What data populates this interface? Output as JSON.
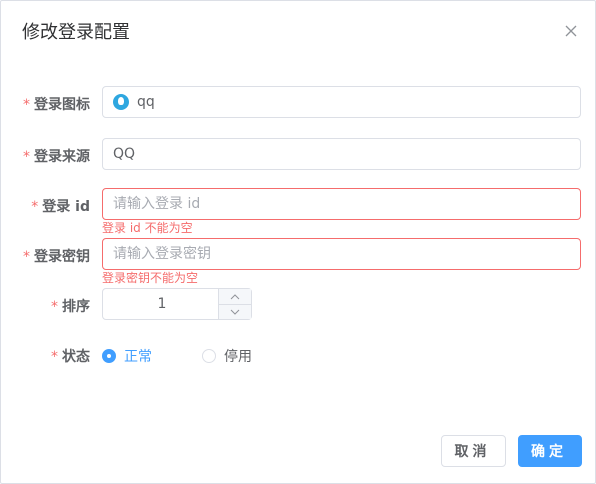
{
  "dialog": {
    "title": "修改登录配置"
  },
  "form": {
    "required_mark": "*",
    "icon": {
      "label": "登录图标",
      "value": "qq",
      "icon_name": "qq-icon"
    },
    "source": {
      "label": "登录来源",
      "value": "QQ"
    },
    "login_id": {
      "label": "登录 id",
      "value": "",
      "placeholder": "请输入登录 id",
      "error": "登录 id 不能为空"
    },
    "secret": {
      "label": "登录密钥",
      "value": "",
      "placeholder": "请输入登录密钥",
      "error": "登录密钥不能为空"
    },
    "sort": {
      "label": "排序",
      "value": "1"
    },
    "status": {
      "label": "状态",
      "options": [
        {
          "label": "正常",
          "checked": true
        },
        {
          "label": "停用",
          "checked": false
        }
      ]
    }
  },
  "footer": {
    "cancel_label": "取消",
    "ok_label": "确定"
  },
  "colors": {
    "primary": "#409eff",
    "danger": "#f56c6c",
    "border": "#dcdfe6",
    "text": "#606266"
  }
}
